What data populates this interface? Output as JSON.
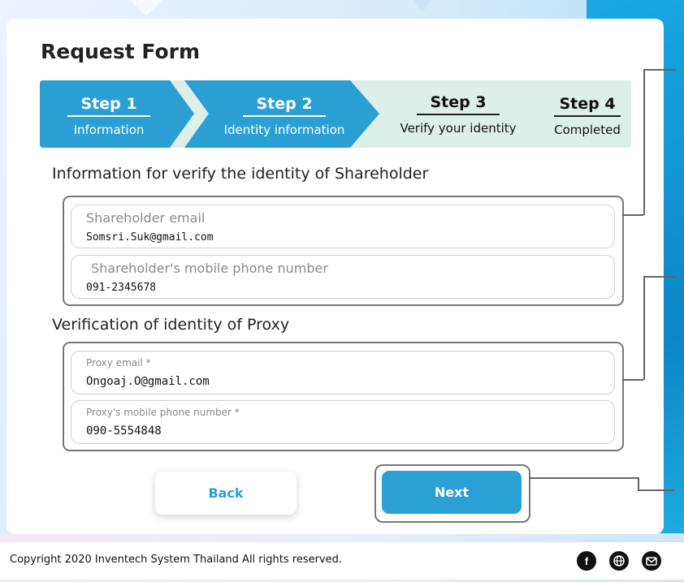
{
  "title": "Request Form",
  "steps": [
    {
      "number": "Step 1",
      "label": "Information"
    },
    {
      "number": "Step 2",
      "label": "Identity information"
    },
    {
      "number": "Step 3",
      "label": "Verify your identity"
    },
    {
      "number": "Step 4",
      "label": "Completed"
    }
  ],
  "shareholder_section": {
    "heading": "Information for verify the identity of Shareholder",
    "email_label": "Shareholder email",
    "email_value": "Somsri.Suk@gmail.com",
    "phone_label": "Shareholder's mobile phone number",
    "phone_value": "091-2345678"
  },
  "proxy_section": {
    "heading": "Verification of identity of Proxy",
    "email_label": "Proxy email *",
    "email_value": "Ongoaj.O@gmail.com",
    "phone_label": "Proxy's mobile phone number *",
    "phone_value": "090-5554848"
  },
  "buttons": {
    "back": "Back",
    "next": "Next"
  },
  "footer": {
    "copyright": "Copyright  2020 Inventech System Thailand All rights reserved."
  },
  "icons": [
    "facebook-icon",
    "globe-icon",
    "mail-icon"
  ],
  "colors": {
    "accent": "#2b9fd3",
    "stepper_bg": "#dcefe9"
  }
}
